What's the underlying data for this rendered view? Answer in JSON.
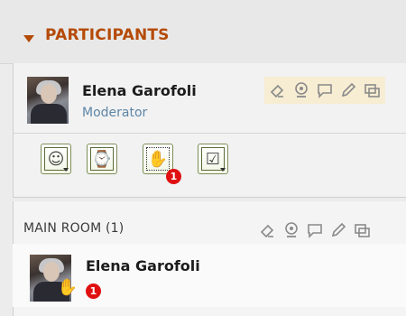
{
  "header": {
    "title": "PARTICIPANTS"
  },
  "current_user": {
    "name": "Elena Garofoli",
    "role": "Moderator",
    "status_icons": [
      "speaker-icon",
      "webcam-icon",
      "chat-bubble-icon",
      "pencil-icon",
      "screen-share-icon"
    ]
  },
  "actions": [
    {
      "id": "emoticon",
      "glyph": "☺",
      "has_dropdown": true
    },
    {
      "id": "away",
      "glyph": "⌚",
      "has_dropdown": false
    },
    {
      "id": "raise-hand",
      "glyph": "✋",
      "has_dropdown": false,
      "badge": "1"
    },
    {
      "id": "agree",
      "glyph": "☑",
      "has_dropdown": true
    }
  ],
  "main_room": {
    "label": "MAIN ROOM (1)",
    "participants": [
      {
        "name": "Elena Garofoli",
        "badge": "1"
      }
    ]
  },
  "colors": {
    "header_text": "#b54a07",
    "role_text": "#5d86a8",
    "badge": "#e01010",
    "button_border": "#7d8e5a"
  }
}
